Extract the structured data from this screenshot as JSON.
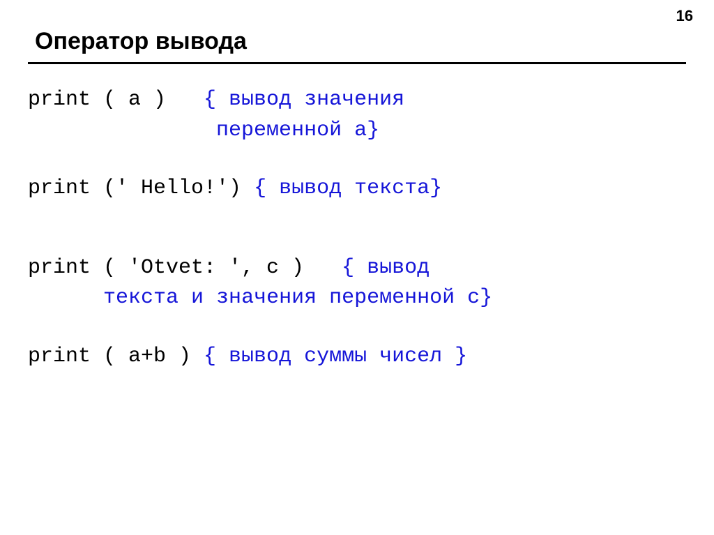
{
  "page": {
    "number": "16",
    "title": "Оператор вывода"
  },
  "examples": [
    {
      "code1": "print ( a )   ",
      "comment1": "{ вывод значения",
      "code2": "               ",
      "comment2": "переменной a}"
    },
    {
      "code1": "print (' Hello!') ",
      "comment1": "{ вывод текста}"
    },
    {
      "code1": "print ( 'Otvet: ', c )   ",
      "comment1": "{ вывод",
      "code2": "      ",
      "comment2": "текста и значения переменной c}"
    },
    {
      "code1": "print ( a+b ) ",
      "comment1": "{ вывод суммы чисел }"
    }
  ]
}
